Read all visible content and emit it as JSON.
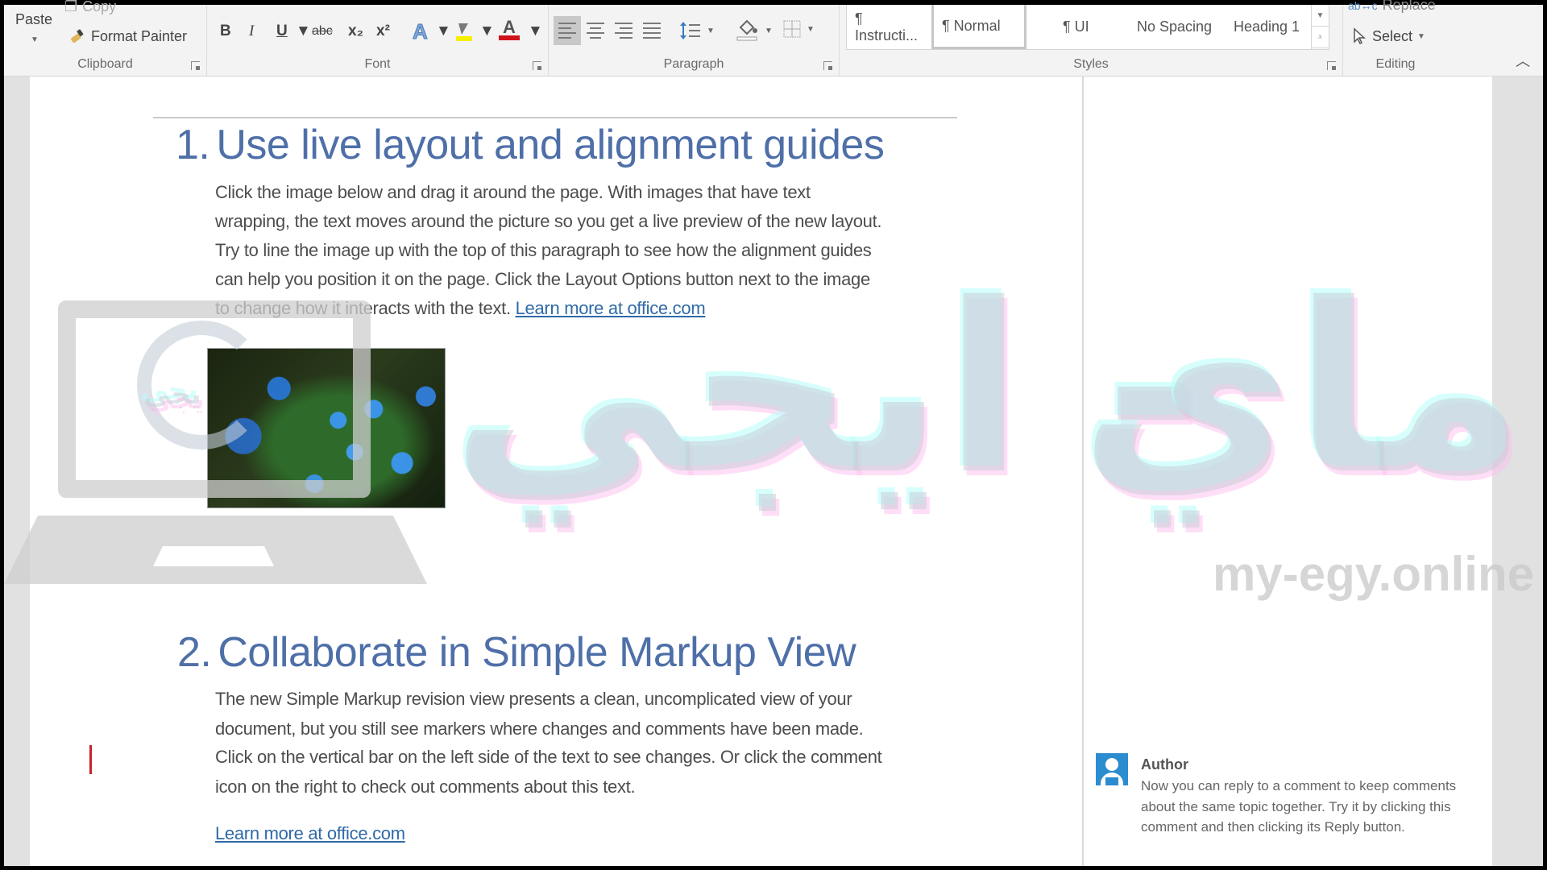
{
  "ribbon": {
    "clipboard": {
      "label": "Clipboard",
      "paste": "Paste",
      "copy": "Copy",
      "format_painter": "Format Painter"
    },
    "font": {
      "label": "Font",
      "bold": "B",
      "italic": "I",
      "underline": "U",
      "strikethrough": "abc",
      "subscript": "x₂",
      "superscript": "x²",
      "text_effects": "A",
      "font_color": "A",
      "highlight_color": "#f5f000",
      "font_color_value": "#d0121b"
    },
    "paragraph": {
      "label": "Paragraph"
    },
    "styles": {
      "label": "Styles",
      "items": [
        {
          "label": "¶ Instructi..."
        },
        {
          "label": "¶ Normal"
        },
        {
          "label": "¶ UI"
        },
        {
          "label": "No Spacing"
        },
        {
          "label": "Heading 1"
        }
      ],
      "selected": "¶ Normal"
    },
    "editing": {
      "label": "Editing",
      "replace": "Replace",
      "select": "Select"
    }
  },
  "document": {
    "section1": {
      "number": "1.",
      "title": "Use live layout and alignment guides",
      "lines": [
        "Click the image below and drag it around the page. With images that have text",
        "wrapping, the text moves around the picture so you get a live preview of the new layout.",
        "Try to line the image up with the top of this paragraph to see how the alignment guides",
        "can help you position it on the page.  Click the Layout Options button next to the image"
      ],
      "last_line": "to change how it interacts with the text.",
      "link": "Learn more at office.com"
    },
    "section2": {
      "number": "2.",
      "title": "Collaborate in Simple Markup View",
      "lines": [
        "The new Simple Markup revision view presents a clean, uncomplicated view of your",
        "document, but you still see markers where changes and comments have been made.",
        "Click on the vertical bar on the left side of the text to see changes. Or click the comment",
        "icon on the right to check out comments about this text."
      ],
      "link": "Learn more at office.com"
    },
    "comment": {
      "author": "Author",
      "text": "Now you can reply to a comment to keep comments about the same topic together. Try it by clicking this comment and then clicking its Reply button."
    }
  },
  "watermark": {
    "arabic_left": "ايجي -",
    "arabic_right": "ماي",
    "site": "my-egy.online",
    "logo_text": "يجي"
  },
  "colors": {
    "heading": "#4e6fa8",
    "link": "#2f6aa8",
    "change_bar": "#c8232c",
    "avatar": "#2b8cd0"
  }
}
